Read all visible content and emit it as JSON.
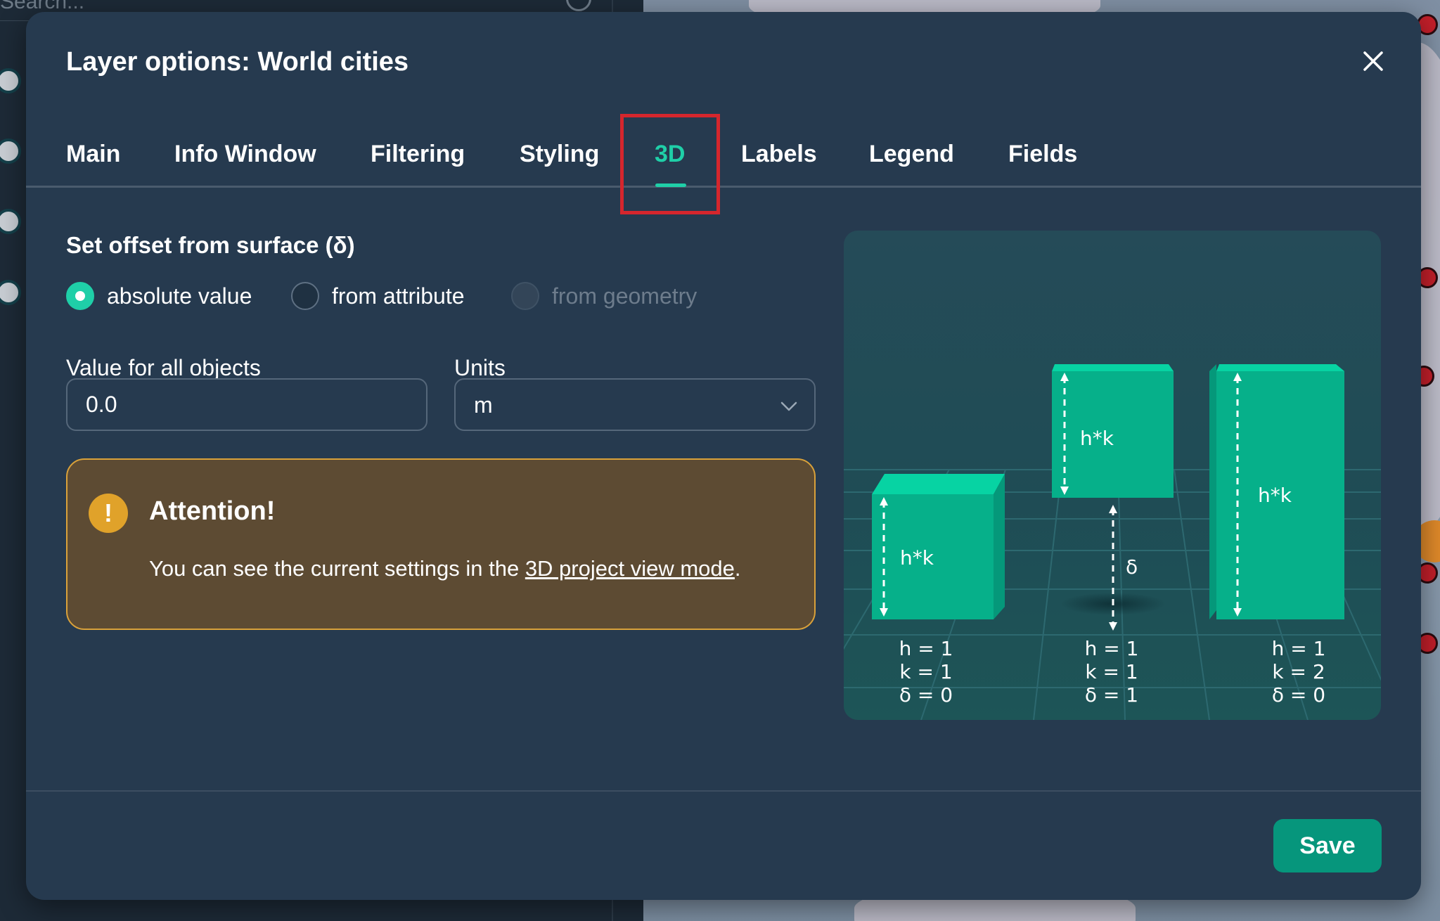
{
  "background": {
    "search_placeholder": "Search..."
  },
  "modal": {
    "title": "Layer options: World cities",
    "close_icon": "close-icon"
  },
  "tabs": [
    {
      "label": "Main",
      "active": false
    },
    {
      "label": "Info Window",
      "active": false
    },
    {
      "label": "Filtering",
      "active": false
    },
    {
      "label": "Styling",
      "active": false
    },
    {
      "label": "3D",
      "active": true
    },
    {
      "label": "Labels",
      "active": false
    },
    {
      "label": "Legend",
      "active": false
    },
    {
      "label": "Fields",
      "active": false
    }
  ],
  "offset": {
    "title": "Set offset from surface (δ)",
    "options": [
      {
        "label": "absolute value",
        "checked": true,
        "disabled": false
      },
      {
        "label": "from attribute",
        "checked": false,
        "disabled": false
      },
      {
        "label": "from geometry",
        "checked": false,
        "disabled": true
      }
    ]
  },
  "value_field": {
    "label": "Value for all objects",
    "value": "0.0"
  },
  "units_field": {
    "label": "Units",
    "value": "m",
    "icon": "chevron-down-icon"
  },
  "alert": {
    "icon": "warning-icon",
    "title": "Attention!",
    "text_before": "You can see the current settings in the ",
    "link_text": "3D project view mode",
    "text_after": "."
  },
  "illustration": {
    "columns": [
      {
        "h": "h = 1",
        "k": "k = 1",
        "d": "δ = 0",
        "bar_label": "h*k"
      },
      {
        "h": "h = 1",
        "k": "k = 1",
        "d": "δ = 1",
        "bar_label": "h*k",
        "offset_label": "δ"
      },
      {
        "h": "h = 1",
        "k": "k = 2",
        "d": "δ = 0",
        "bar_label": "h*k"
      }
    ]
  },
  "footer": {
    "save_label": "Save"
  },
  "colors": {
    "accent": "#1fcfa8",
    "modal_bg": "#263a4f",
    "warning_bg": "#5d4b33",
    "warning_border": "#d9a13a",
    "save_button": "#06967c",
    "highlight_box": "#d5262d",
    "bar_green": "#06b08a"
  }
}
